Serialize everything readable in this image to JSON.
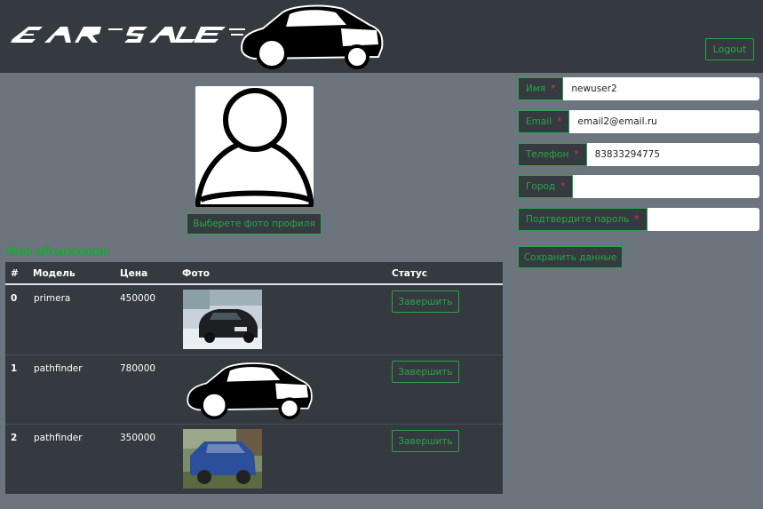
{
  "header": {
    "logo_text": "CAR SALE",
    "logout_label": "Logout"
  },
  "profile": {
    "choose_photo_label": "Выберете фото профиля"
  },
  "listings": {
    "title": "Мои объявления",
    "columns": [
      "#",
      "Модель",
      "Цена",
      "Фото",
      "Статус"
    ],
    "rows": [
      {
        "index": "0",
        "model": "primera",
        "price": "450000",
        "photo": "dark-sedan-in-snow-photo",
        "action": "Завершить"
      },
      {
        "index": "1",
        "model": "pathfinder",
        "price": "780000",
        "photo": "car-silhouette-placeholder",
        "action": "Завершить"
      },
      {
        "index": "2",
        "model": "pathfinder",
        "price": "350000",
        "photo": "blue-suv-photo",
        "action": "Завершить"
      }
    ]
  },
  "form": {
    "fields": [
      {
        "label": "Имя",
        "required": "*",
        "value": "newuser2"
      },
      {
        "label": "Email",
        "required": "*",
        "value": "email2@email.ru"
      },
      {
        "label": "Телефон",
        "required": "*",
        "value": "83833294775"
      },
      {
        "label": "Город",
        "required": "*",
        "value": ""
      },
      {
        "label": "Подтвердите пароль",
        "required": "*",
        "value": ""
      }
    ],
    "save_label": "Сохранить данные"
  },
  "colors": {
    "page_bg": "#6c757d",
    "dark": "#343a40",
    "accent_green": "#28a745",
    "required_red": "#dc3545"
  }
}
